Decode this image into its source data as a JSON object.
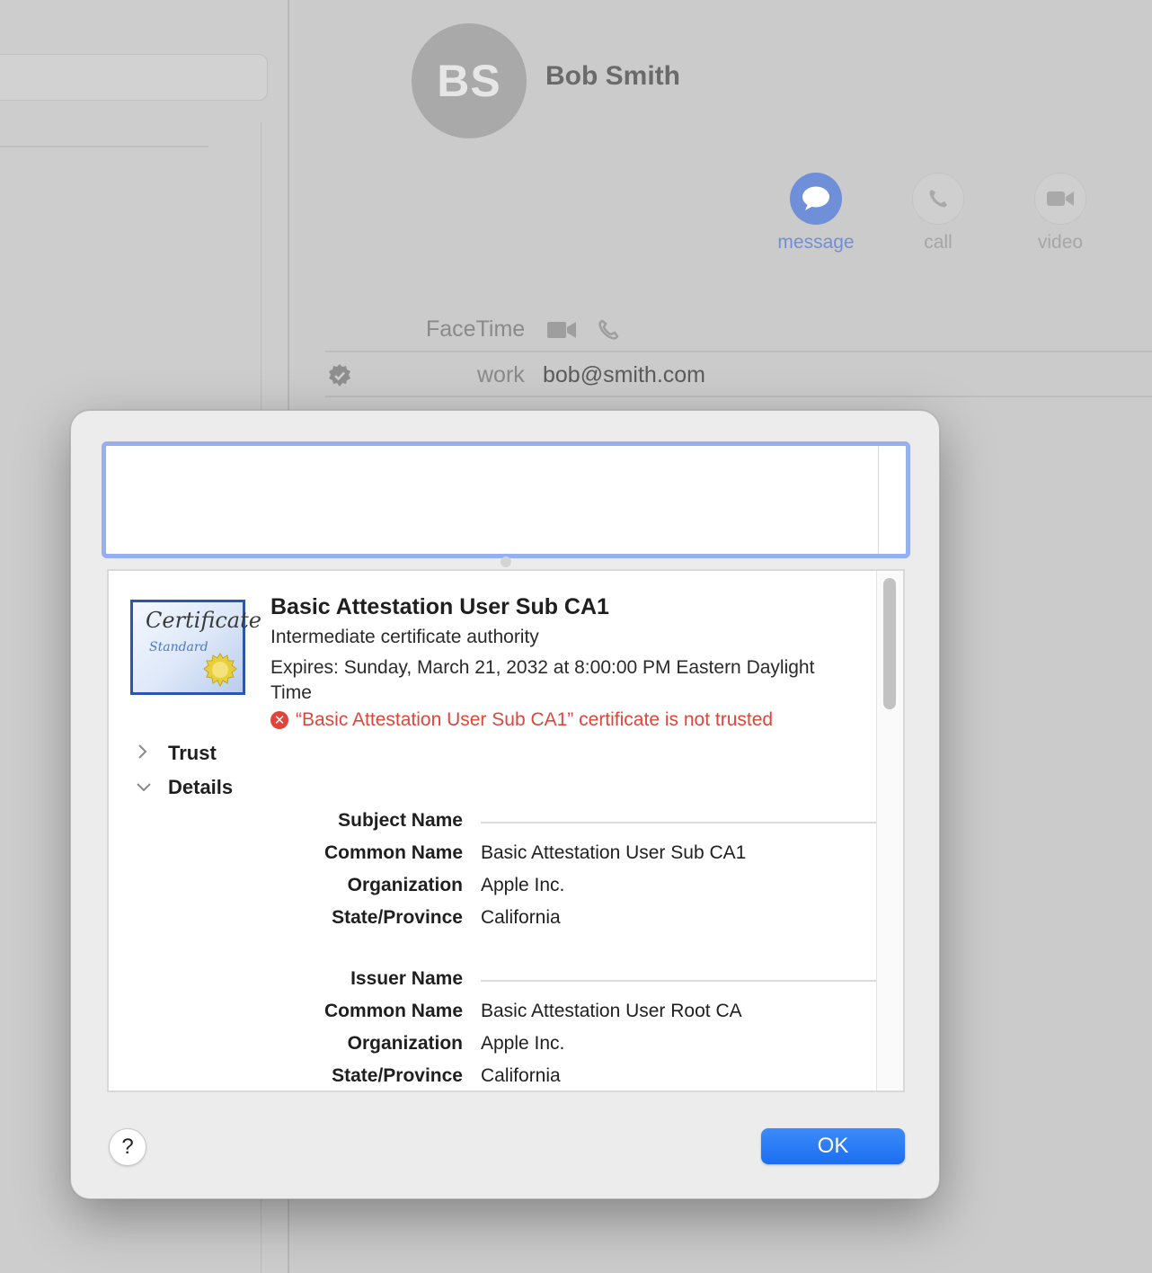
{
  "contact": {
    "initials": "BS",
    "name": "Bob Smith",
    "actions": [
      {
        "label": "message",
        "icon": "message-bubble-icon"
      },
      {
        "label": "call",
        "icon": "phone-icon"
      },
      {
        "label": "video",
        "icon": "video-camera-icon"
      }
    ],
    "facetime_label": "FaceTime",
    "email_label": "work",
    "email_value": "bob@smith.com"
  },
  "dialog": {
    "certificate": {
      "icon_text_1": "Certificate",
      "icon_text_2": "Standard",
      "title": "Basic Attestation User Sub CA1",
      "subtitle": "Intermediate certificate authority",
      "expires": "Expires: Sunday, March 21, 2032 at 8:00:00 PM Eastern Daylight Time",
      "warning": "“Basic Attestation User Sub CA1” certificate is not trusted"
    },
    "sections": {
      "trust": "Trust",
      "details": "Details"
    },
    "subject": {
      "heading": "Subject Name",
      "common_name_label": "Common Name",
      "common_name": "Basic Attestation User Sub CA1",
      "organization_label": "Organization",
      "organization": "Apple Inc.",
      "state_label": "State/Province",
      "state": "California"
    },
    "issuer": {
      "heading": "Issuer Name",
      "common_name_label": "Common Name",
      "common_name": "Basic Attestation User Root CA",
      "organization_label": "Organization",
      "organization": "Apple Inc.",
      "state_label": "State/Province",
      "state": "California"
    },
    "help_label": "?",
    "ok_label": "OK"
  },
  "colors": {
    "accent": "#1c6ef2",
    "warning": "#e0453a",
    "selection_border": "#96aef2"
  }
}
